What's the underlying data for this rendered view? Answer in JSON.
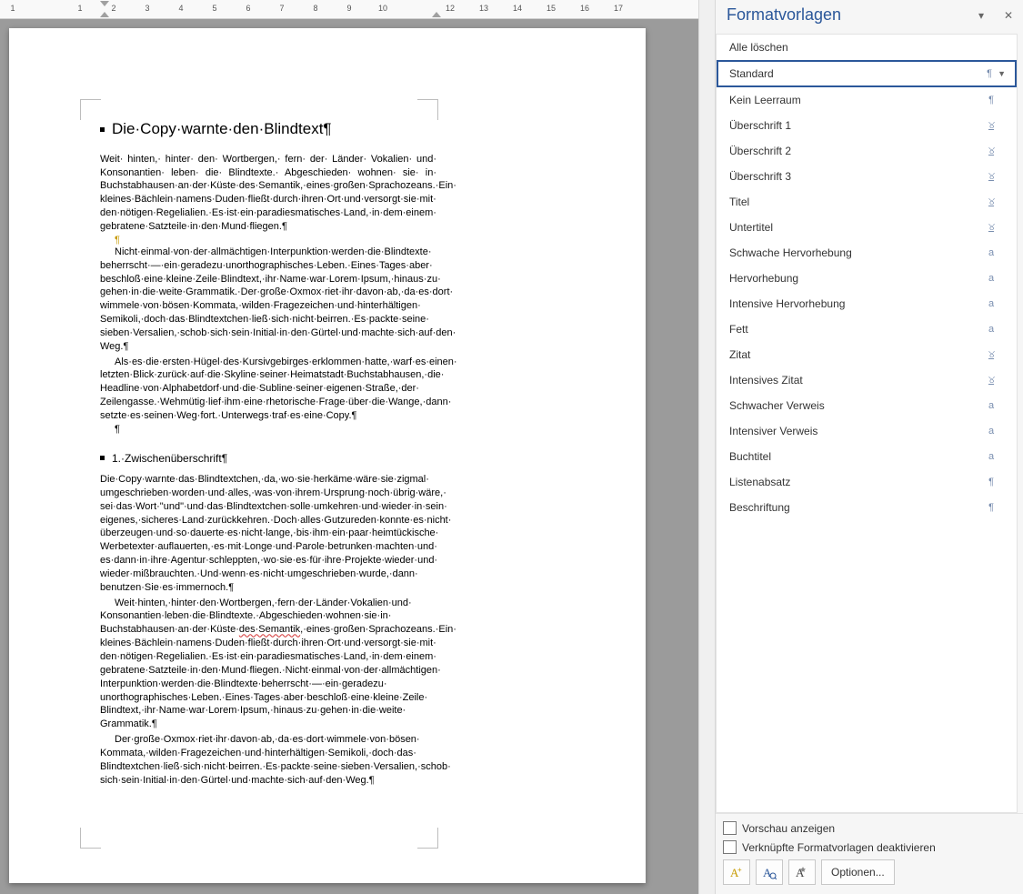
{
  "ruler": {
    "marks": [
      "3",
      "",
      "1",
      "",
      "1",
      "2",
      "3",
      "4",
      "5",
      "6",
      "7",
      "8",
      "9",
      "10",
      "",
      "12",
      "13",
      "14",
      "15",
      "16",
      "17"
    ]
  },
  "document": {
    "h1": "Die·Copy·warnte·den·Blindtext¶",
    "p1": "Weit· hinten,· hinter· den· Wortbergen,· fern· der· Länder· Vokalien· und· Konsonantien· leben· die· Blindtexte.· Abgeschieden· wohnen· sie· in· Buchstabhausen·an·der·Küste·des·Semantik,·eines·großen·Sprachozeans.·Ein· kleines·Bächlein·namens·Duden·fließt·durch·ihren·Ort·und·versorgt·sie·mit· den·nötigen·Regelialien.·Es·ist·ein·paradiesmatisches·Land,·in·dem·einem· gebratene·Satzteile·in·den·Mund·fliegen.¶",
    "pil": "¶",
    "p2": "Nicht·einmal·von·der·allmächtigen·Interpunktion·werden·die·Blindtexte· beherrscht·—·ein·geradezu·unorthographisches·Leben.·Eines·Tages·aber· beschloß·eine·kleine·Zeile·Blindtext,·ihr·Name·war·Lorem·Ipsum,·hinaus·zu· gehen·in·die·weite·Grammatik.·Der·große·Oxmox·riet·ihr·davon·ab,·da·es·dort· wimmele·von·bösen·Kommata,·wilden·Fragezeichen·und·hinterhältigen· Semikoli,·doch·das·Blindtextchen·ließ·sich·nicht·beirren.·Es·packte·seine· sieben·Versalien,·schob·sich·sein·Initial·in·den·Gürtel·und·machte·sich·auf·den· Weg.¶",
    "p3": "Als·es·die·ersten·Hügel·des·Kursivgebirges·erklommen·hatte,·warf·es·einen· letzten·Blick·zurück·auf·die·Skyline·seiner·Heimatstadt·Buchstabhausen,·die· Headline·von·Alphabetdorf·und·die·Subline·seiner·eigenen·Straße,·der· Zeilengasse.·Wehmütig·lief·ihm·eine·rhetorische·Frage·über·die·Wange,·dann· setzte·es·seinen·Weg·fort.·Unterwegs·traf·es·eine·Copy.¶",
    "pil2": "¶",
    "h2": "1.·Zwischenüberschrift¶",
    "p4": "Die·Copy·warnte·das·Blindtextchen,·da,·wo·sie·herkäme·wäre·sie·zigmal· umgeschrieben·worden·und·alles,·was·von·ihrem·Ursprung·noch·übrig·wäre,· sei·das·Wort·\"und\"·und·das·Blindtextchen·solle·umkehren·und·wieder·in·sein· eigenes,·sicheres·Land·zurückkehren.·Doch·alles·Gutzureden·konnte·es·nicht· überzeugen·und·so·dauerte·es·nicht·lange,·bis·ihm·ein·paar·heimtückische· Werbetexter·auflauerten,·es·mit·Longe·und·Parole·betrunken·machten·und· es·dann·in·ihre·Agentur·schleppten,·wo·sie·es·für·ihre·Projekte·wieder·und· wieder·mißbrauchten.·Und·wenn·es·nicht·umgeschrieben·wurde,·dann· benutzen·Sie·es·immernoch.¶",
    "p5a": "Weit·hinten,·hinter·den·Wortbergen,·fern·der·Länder·Vokalien·und· Konsonantien·leben·die·Blindtexte.·Abgeschieden·wohnen·sie·in· Buchstabhausen·an·der·Küste·",
    "p5err": "des·Semantik",
    "p5b": ",·eines·großen·Sprachozeans.·Ein· kleines·Bächlein·namens·Duden·fließt·durch·ihren·Ort·und·versorgt·sie·mit· den·nötigen·Regelialien.·Es·ist·ein·paradiesmatisches·Land,·in·dem·einem· gebratene·Satzteile·in·den·Mund·fliegen.·Nicht·einmal·von·der·allmächtigen· Interpunktion·werden·die·Blindtexte·beherrscht·—·ein·geradezu· unorthographisches·Leben.·Eines·Tages·aber·beschloß·eine·kleine·Zeile· Blindtext,·ihr·Name·war·Lorem·Ipsum,·hinaus·zu·gehen·in·die·weite· Grammatik.¶",
    "p6": "Der·große·Oxmox·riet·ihr·davon·ab,·da·es·dort·wimmele·von·bösen· Kommata,·wilden·Fragezeichen·und·hinterhältigen·Semikoli,·doch·das· Blindtextchen·ließ·sich·nicht·beirren.·Es·packte·seine·sieben·Versalien,·schob· sich·sein·Initial·in·den·Gürtel·und·machte·sich·auf·den·Weg.¶"
  },
  "pane": {
    "title": "Formatvorlagen",
    "styles": [
      {
        "label": "Alle löschen",
        "mark": "",
        "selected": false
      },
      {
        "label": "Standard",
        "mark": "para",
        "selected": true
      },
      {
        "label": "Kein Leerraum",
        "mark": "para",
        "selected": false
      },
      {
        "label": "Überschrift 1",
        "mark": "linked",
        "selected": false
      },
      {
        "label": "Überschrift 2",
        "mark": "linked",
        "selected": false
      },
      {
        "label": "Überschrift 3",
        "mark": "linked",
        "selected": false
      },
      {
        "label": "Titel",
        "mark": "linked",
        "selected": false
      },
      {
        "label": "Untertitel",
        "mark": "linked",
        "selected": false
      },
      {
        "label": "Schwache Hervorhebung",
        "mark": "char",
        "selected": false
      },
      {
        "label": "Hervorhebung",
        "mark": "char",
        "selected": false
      },
      {
        "label": "Intensive Hervorhebung",
        "mark": "char",
        "selected": false
      },
      {
        "label": "Fett",
        "mark": "char",
        "selected": false
      },
      {
        "label": "Zitat",
        "mark": "linked",
        "selected": false
      },
      {
        "label": "Intensives Zitat",
        "mark": "linked",
        "selected": false
      },
      {
        "label": "Schwacher Verweis",
        "mark": "char",
        "selected": false
      },
      {
        "label": "Intensiver Verweis",
        "mark": "char",
        "selected": false
      },
      {
        "label": "Buchtitel",
        "mark": "char",
        "selected": false
      },
      {
        "label": "Listenabsatz",
        "mark": "para",
        "selected": false
      },
      {
        "label": "Beschriftung",
        "mark": "para",
        "selected": false
      }
    ],
    "footer": {
      "preview": "Vorschau anzeigen",
      "disable_linked": "Verknüpfte Formatvorlagen deaktivieren",
      "options": "Optionen..."
    }
  }
}
